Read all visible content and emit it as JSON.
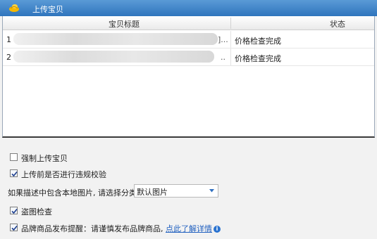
{
  "window": {
    "title": "上传宝贝"
  },
  "table": {
    "columns": [
      "宝贝标题",
      "状态"
    ],
    "rows": [
      {
        "index": "1",
        "title_trail": "]...",
        "status": "价格检查完成"
      },
      {
        "index": "2",
        "title_trail": "..",
        "status": "价格检查完成"
      }
    ]
  },
  "options": {
    "force_upload": {
      "label": "强制上传宝贝",
      "checked": false
    },
    "pre_check": {
      "label": "上传前是否进行违规校验",
      "checked": true
    },
    "image_category": {
      "label": "如果描述中包含本地图片, 请选择分类",
      "selected": "默认图片"
    },
    "theft_check": {
      "label": "盗图检查",
      "checked": true
    },
    "brand_reminder": {
      "label": "品牌商品发布提醒：请谨慎发布品牌商品,",
      "link": "点此了解详情",
      "checked": true
    }
  }
}
